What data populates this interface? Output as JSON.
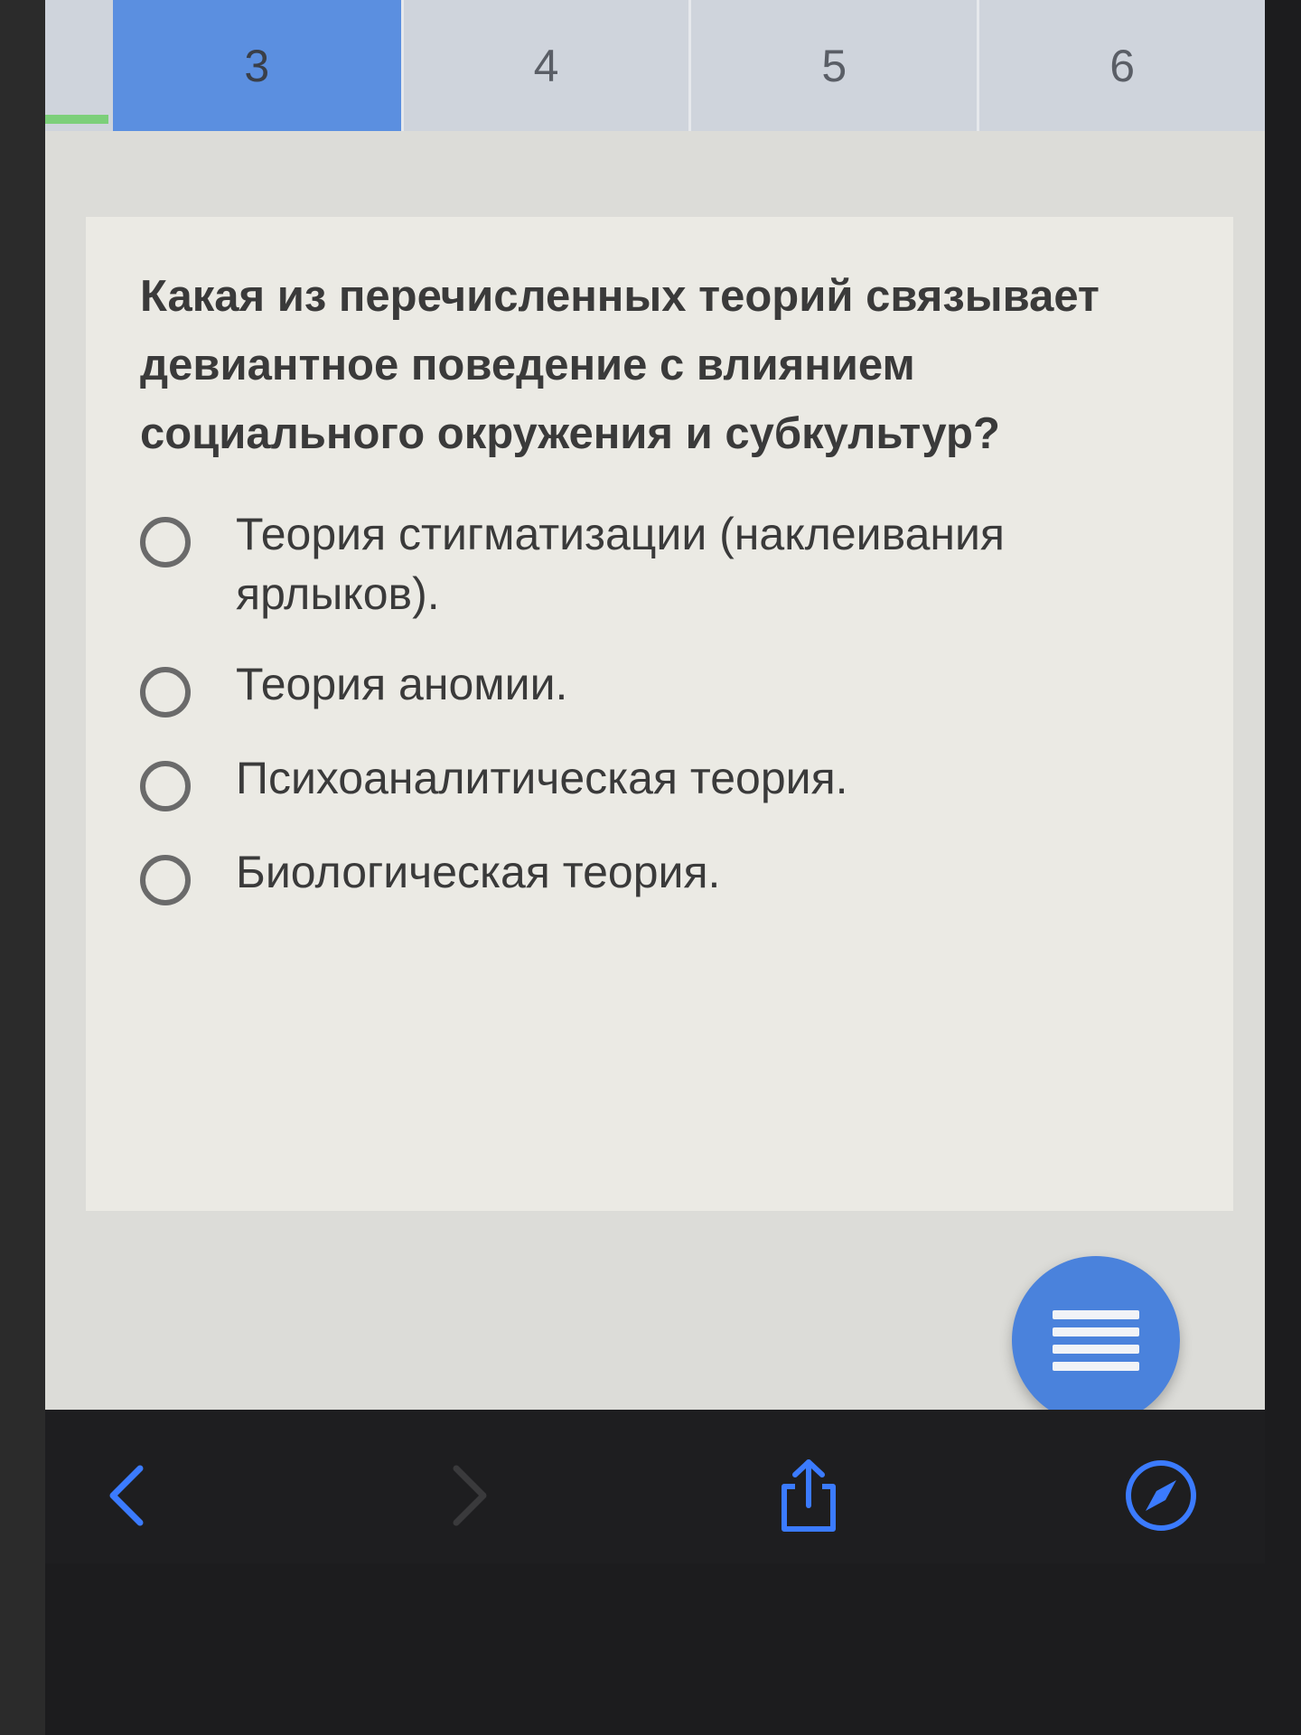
{
  "tabs": [
    {
      "label": "3",
      "active": true
    },
    {
      "label": "4",
      "active": false
    },
    {
      "label": "5",
      "active": false
    },
    {
      "label": "6",
      "active": false
    }
  ],
  "question": {
    "text": "Какая из перечисленных теорий связывает девиантное поведение с влиянием социального окружения и субкультур?"
  },
  "options": [
    {
      "label": "Теория стигматизации (наклеивания ярлыков)."
    },
    {
      "label": "Теория аномии."
    },
    {
      "label": "Психоаналитическая теория."
    },
    {
      "label": "Биологическая теория."
    }
  ],
  "fab": {
    "icon": "menu-icon"
  },
  "toolbar": {
    "back_icon": "chevron-left-icon",
    "forward_icon": "chevron-right-icon",
    "share_icon": "share-icon",
    "compass_icon": "compass-icon"
  },
  "colors": {
    "accent": "#4a82dc",
    "tab_active": "#5b8fe0",
    "card_bg": "#ebeae4",
    "progress_green": "#7ccf7a"
  }
}
